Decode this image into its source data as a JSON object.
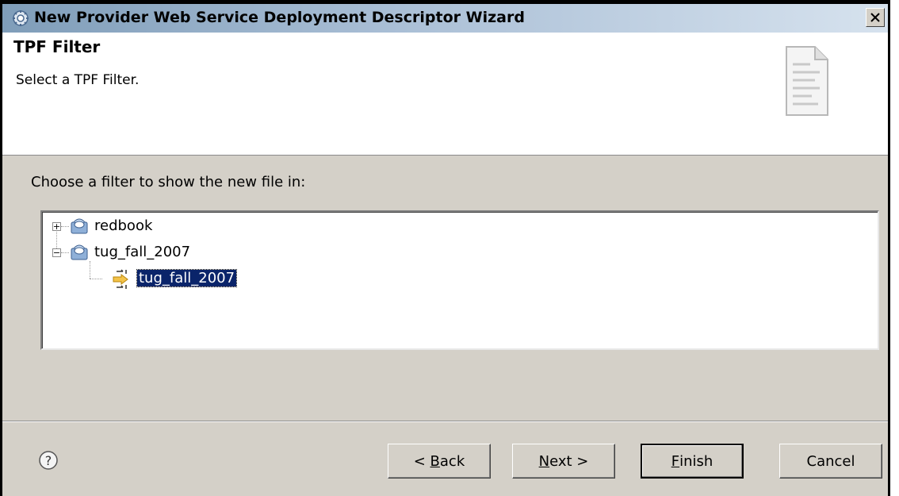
{
  "window": {
    "title": "New Provider Web Service Deployment Descriptor Wizard",
    "close_label": "×"
  },
  "header": {
    "title": "TPF Filter",
    "description": "Select a TPF Filter."
  },
  "content": {
    "prompt": "Choose a filter to show the new file in:"
  },
  "tree": {
    "items": [
      {
        "label": "redbook",
        "expanded": false,
        "icon": "project-icon"
      },
      {
        "label": "tug_fall_2007",
        "expanded": true,
        "icon": "project-icon",
        "children": [
          {
            "label": "tug_fall_2007",
            "icon": "filter-icon",
            "selected": true
          }
        ]
      }
    ]
  },
  "buttons": {
    "back_prefix": "< ",
    "back_mnemonic": "B",
    "back_rest": "ack",
    "next_mnemonic": "N",
    "next_rest": "ext >",
    "finish_mnemonic": "F",
    "finish_rest": "inish",
    "cancel": "Cancel"
  },
  "colors": {
    "selection": "#0a246a",
    "dialog_bg": "#d4d0c8"
  }
}
